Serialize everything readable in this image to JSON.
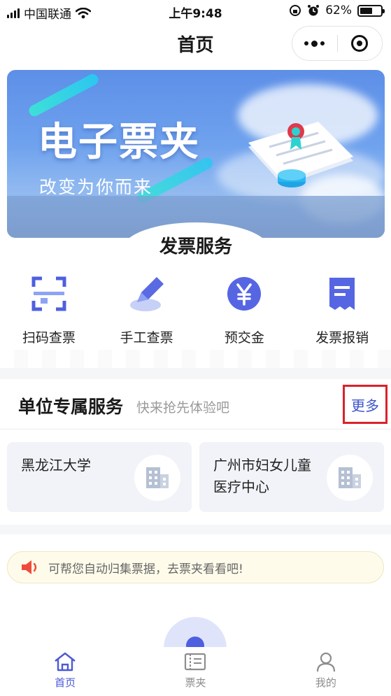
{
  "status_bar": {
    "carrier": "中国联通",
    "time": "上午9:48",
    "battery": "62%",
    "battery_level": 0.62
  },
  "nav": {
    "title": "首页",
    "menu_icon": "more-dots-icon",
    "close_icon": "target-circle-icon"
  },
  "banner": {
    "title": "电子票夹",
    "subtitle": "改变为你而来"
  },
  "invoice_section": {
    "title": "发票服务",
    "items": [
      {
        "label": "扫码查票",
        "icon": "scan-icon"
      },
      {
        "label": "手工查票",
        "icon": "pen-icon"
      },
      {
        "label": "预交金",
        "icon": "yen-icon"
      },
      {
        "label": "发票报销",
        "icon": "receipt-icon"
      }
    ]
  },
  "unit_section": {
    "title": "单位专属服务",
    "subtitle": "快来抢先体验吧",
    "more_label": "更多",
    "cards": [
      {
        "name": "黑龙江大学",
        "icon": "building-icon"
      },
      {
        "name_line1": "广州市妇女儿童",
        "name_line2": "医疗中心",
        "icon": "building-icon"
      }
    ]
  },
  "notice": {
    "text": "可帮您自动归集票据，去票夹看看吧!",
    "icon": "speaker-icon"
  },
  "tabbar": {
    "tabs": [
      {
        "label": "首页",
        "icon": "home-icon",
        "active": true
      },
      {
        "label": "票夹",
        "icon": "ticket-folder-icon",
        "active": false
      },
      {
        "label": "我的",
        "icon": "user-icon",
        "active": false
      }
    ]
  },
  "colors": {
    "accent": "#4a59d6",
    "highlight_border": "#d9232b",
    "banner_blue": "#5d8fe8"
  }
}
